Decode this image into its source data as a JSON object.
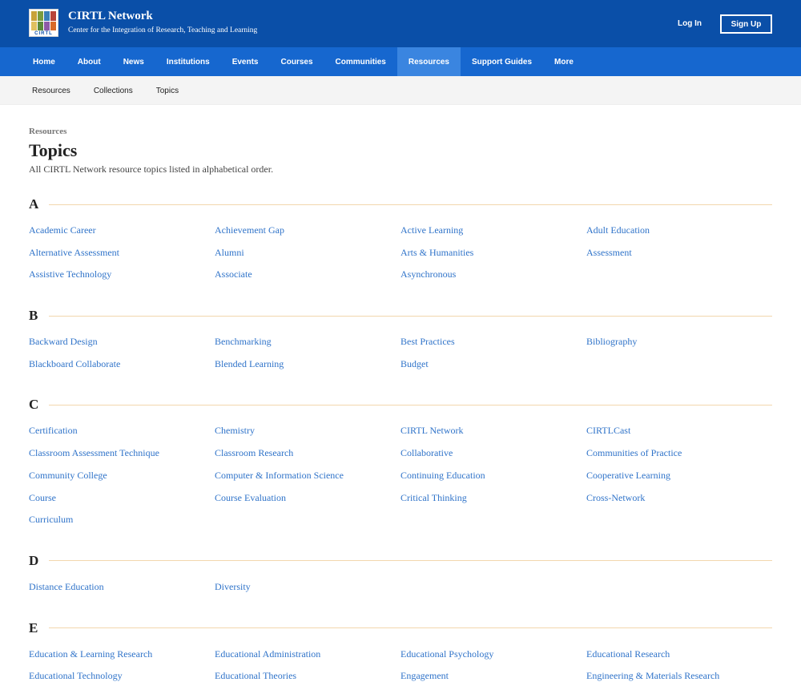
{
  "header": {
    "site_name": "CIRTL Network",
    "tagline": "Center for the Integration of Research, Teaching and Learning",
    "logo_text": "CIRTL",
    "login_label": "Log In",
    "signup_label": "Sign Up",
    "colors": {
      "brand": "#0a4fa8",
      "nav": "#1667cf",
      "nav_active": "#3a85e0",
      "link": "#2f73c9",
      "rule": "#f2d7ad"
    }
  },
  "mainnav": [
    "Home",
    "About",
    "News",
    "Institutions",
    "Events",
    "Courses",
    "Communities",
    "Resources",
    "Support Guides",
    "More"
  ],
  "mainnav_active": "Resources",
  "subnav": [
    "Resources",
    "Collections",
    "Topics"
  ],
  "breadcrumb": "Resources",
  "title": "Topics",
  "description": "All CIRTL Network resource topics listed in alphabetical order.",
  "sections": [
    {
      "letter": "A",
      "topics": [
        "Academic Career",
        "Achievement Gap",
        "Active Learning",
        "Adult Education",
        "Alternative Assessment",
        "Alumni",
        "Arts & Humanities",
        "Assessment",
        "Assistive Technology",
        "Associate",
        "Asynchronous"
      ]
    },
    {
      "letter": "B",
      "topics": [
        "Backward Design",
        "Benchmarking",
        "Best Practices",
        "Bibliography",
        "Blackboard Collaborate",
        "Blended Learning",
        "Budget"
      ]
    },
    {
      "letter": "C",
      "topics": [
        "Certification",
        "Chemistry",
        "CIRTL Network",
        "CIRTLCast",
        "Classroom Assessment Technique",
        "Classroom Research",
        "Collaborative",
        "Communities of Practice",
        "Community College",
        "Computer & Information Science",
        "Continuing Education",
        "Cooperative Learning",
        "Course",
        "Course Evaluation",
        "Critical Thinking",
        "Cross-Network",
        "Curriculum"
      ]
    },
    {
      "letter": "D",
      "topics": [
        "Distance Education",
        "Diversity"
      ]
    },
    {
      "letter": "E",
      "topics": [
        "Education & Learning Research",
        "Educational Administration",
        "Educational Psychology",
        "Educational Research",
        "Educational Technology",
        "Educational Theories",
        "Engagement",
        "Engineering & Materials Research"
      ]
    }
  ]
}
